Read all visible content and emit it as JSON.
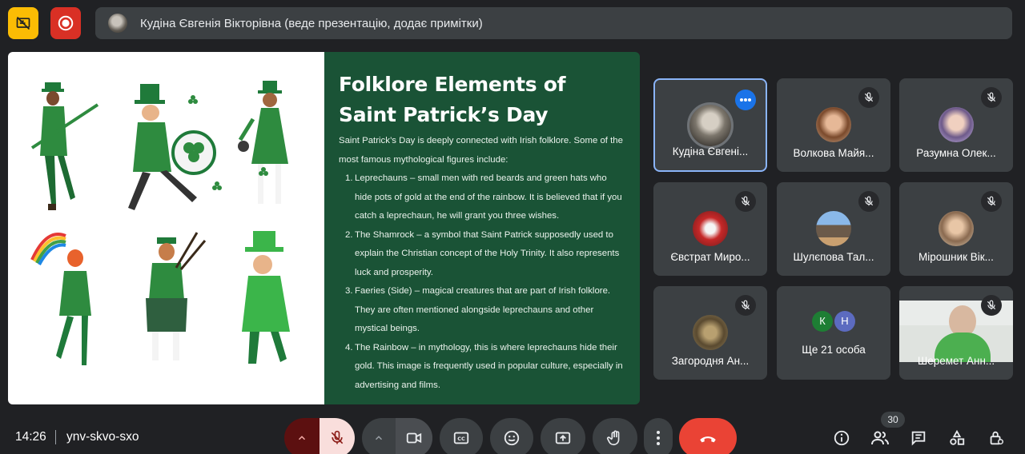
{
  "top_bar": {
    "presenter_text": "Кудіна Євгенія Вікторівна (веде презентацію, додає примітки)"
  },
  "slide": {
    "title_line1": "Folklore Elements of",
    "title_line2": "Saint Patrick’s Day",
    "intro": "Saint Patrick’s Day is deeply connected with Irish folklore. Some of the most famous mythological figures include:",
    "items": [
      {
        "num": "1.",
        "text": "Leprechauns – small men with red beards and green hats who hide pots of gold at the end of the rainbow. It is believed that if you catch a leprechaun, he will grant you three wishes."
      },
      {
        "num": "2.",
        "text": "The Shamrock – a symbol that Saint Patrick supposedly used to explain the Christian concept of the Holy Trinity. It also represents luck and prosperity."
      },
      {
        "num": "3.",
        "text": "Faeries (Side) – magical creatures that are part of Irish folklore. They are often mentioned alongside leprechauns and other mystical beings."
      },
      {
        "num": "4.",
        "text": "The Rainbow – in mythology, this is where leprechauns hide their gold. This image is frequently used in popular culture, especially in advertising and films."
      }
    ]
  },
  "participants": [
    {
      "name": "Кудіна Євгені..."
    },
    {
      "name": "Волкова Майя..."
    },
    {
      "name": "Разумна Олек..."
    },
    {
      "name": "Євстрат Миро..."
    },
    {
      "name": "Шулєпова Тал..."
    },
    {
      "name": "Мірошник Вік..."
    },
    {
      "name": "Загородня Ан..."
    },
    {
      "name": "Ще 21 особа",
      "initials": [
        "К",
        "Н"
      ]
    },
    {
      "name": "Шеремет Анн..."
    }
  ],
  "bottom_bar": {
    "time": "14:26",
    "meeting_code": "ynv-skvo-sxo",
    "people_count": "30"
  },
  "colors": {
    "background": "#202124",
    "tile": "#3c4043",
    "slide_green": "#1a5336",
    "end_call": "#ea4335",
    "record": "#d93025",
    "warn": "#fbbc04",
    "accent": "#8ab4f8"
  },
  "icons": [
    "no-presentation-icon",
    "record-icon",
    "mic-off-icon",
    "camera-icon",
    "captions-icon",
    "emoji-icon",
    "present-icon",
    "raise-hand-icon",
    "more-vert-icon",
    "call-end-icon",
    "info-icon",
    "people-icon",
    "chat-icon",
    "activities-icon",
    "host-controls-icon"
  ]
}
